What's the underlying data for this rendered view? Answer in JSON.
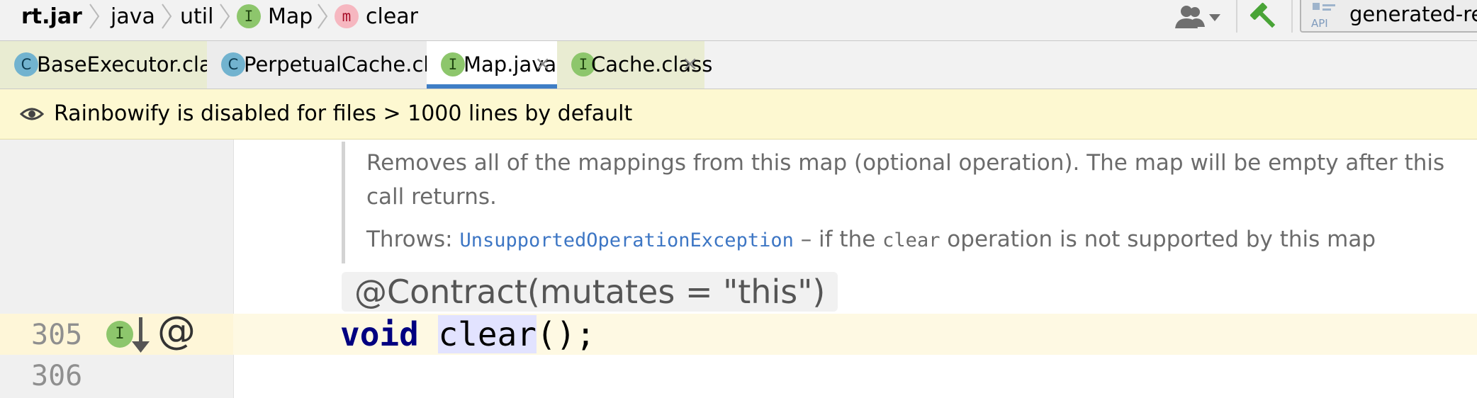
{
  "breadcrumb": {
    "items": [
      {
        "label": "rt.jar",
        "badge": ""
      },
      {
        "label": "java",
        "badge": ""
      },
      {
        "label": "util",
        "badge": ""
      },
      {
        "label": "Map",
        "badge": "I"
      },
      {
        "label": "clear",
        "badge": "m"
      }
    ]
  },
  "toolbar": {
    "user_icon": "user-dropdown-icon",
    "build_icon": "hammer-icon",
    "api_label": "generated-re",
    "api_icon_text": "API"
  },
  "tabs": [
    {
      "label": "BaseExecutor.class",
      "badge": "C",
      "state": "test"
    },
    {
      "label": "PerpetualCache.class",
      "badge": "C",
      "state": "plain"
    },
    {
      "label": "Map.java",
      "badge": "I",
      "state": "active"
    },
    {
      "label": "Cache.class",
      "badge": "I",
      "state": "test"
    }
  ],
  "tab_close_glyph": "×",
  "banner": {
    "text": "Rainbowify is disabled for files > 1000 lines by default",
    "icon": "eye-icon"
  },
  "doc": {
    "line1": "Removes all of the mappings from this map (optional operation). The map will be empty after this",
    "line2": "call returns.",
    "throws_label": "Throws:",
    "throws_link": "UnsupportedOperationException",
    "throws_pre": " – if the ",
    "throws_code": "clear",
    "throws_post": " operation is not supported by this map"
  },
  "contract": "@Contract(mutates = \"this\")",
  "lines": {
    "first": "305",
    "second": "306"
  },
  "gutter": {
    "implements_badge": "I",
    "annotation_glyph": "@"
  },
  "code": {
    "keyword": "void",
    "space": " ",
    "method": "clear",
    "rest": "();"
  },
  "colors": {
    "accent_tab_underline": "#3f7ec5",
    "banner_background": "#fdf8d1",
    "keyword": "#000080",
    "link": "#3d76c4",
    "caret_row": "#fef9e3"
  }
}
